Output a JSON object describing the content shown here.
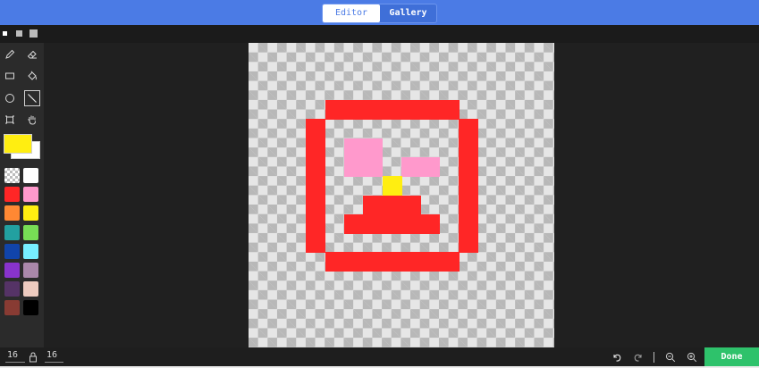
{
  "header": {
    "tabs": [
      {
        "label": "Editor",
        "active": true
      },
      {
        "label": "Gallery",
        "active": false
      }
    ]
  },
  "tools": [
    "pencil-icon",
    "eraser-icon",
    "rectangle-icon",
    "fill-bucket-icon",
    "circle-icon",
    "line-icon",
    "select-icon",
    "hand-icon"
  ],
  "active_tool": "line-icon",
  "colors": {
    "primary": "#ffee11",
    "secondary": "#ffffff",
    "palette": [
      "transparent",
      "#ffffff",
      "#ff2626",
      "#ff99cc",
      "#ff8833",
      "#ffee11",
      "#22a0a0",
      "#77dd55",
      "#1144aa",
      "#77eeff",
      "#8833cc",
      "#aa88aa",
      "#553366",
      "#eeccc0",
      "#883b33",
      "#000000"
    ]
  },
  "canvas": {
    "grid_size": 16,
    "pixels": [
      {
        "c": 4,
        "r": 3,
        "w": 7,
        "h": 1,
        "color": "#ff2626"
      },
      {
        "c": 3,
        "r": 4,
        "w": 1,
        "h": 7,
        "color": "#ff2626"
      },
      {
        "c": 11,
        "r": 4,
        "w": 1,
        "h": 7,
        "color": "#ff2626"
      },
      {
        "c": 4,
        "r": 11,
        "w": 7,
        "h": 1,
        "color": "#ff2626"
      },
      {
        "c": 5,
        "r": 5,
        "w": 2,
        "h": 2,
        "color": "#ff99cc"
      },
      {
        "c": 8,
        "r": 6,
        "w": 2,
        "h": 1,
        "color": "#ff99cc"
      },
      {
        "c": 7,
        "r": 7,
        "w": 1,
        "h": 1,
        "color": "#ffee11"
      },
      {
        "c": 6,
        "r": 8,
        "w": 3,
        "h": 1,
        "color": "#ff2626"
      },
      {
        "c": 5,
        "r": 9,
        "w": 5,
        "h": 1,
        "color": "#ff2626"
      }
    ]
  },
  "footer": {
    "width": "16",
    "height": "16",
    "done_label": "Done"
  }
}
